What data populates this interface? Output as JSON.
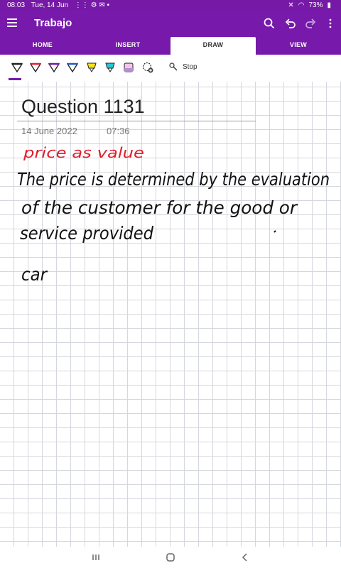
{
  "status": {
    "time": "08:03",
    "date": "Tue, 14 Jun",
    "battery": "73%"
  },
  "app": {
    "title": "Trabajo"
  },
  "tabs": [
    {
      "label": "HOME"
    },
    {
      "label": "INSERT"
    },
    {
      "label": "DRAW",
      "active": true
    },
    {
      "label": "VIEW"
    }
  ],
  "toolbar": {
    "pens": [
      "black-pen",
      "red-pen",
      "purple-pen",
      "blue-pen",
      "yellow-highlighter",
      "cyan-highlighter",
      "pink-highlighter",
      "add-tool"
    ],
    "stop_label": "Stop"
  },
  "page": {
    "title": "Question 1131",
    "date": "14 June 2022",
    "time": "07:36",
    "ink": {
      "heading": "price as value",
      "line1": "The price is determined by the evaluation",
      "line2": "of the customer for the good or",
      "line3": "service provided",
      "line4": "car"
    }
  },
  "colors": {
    "accent": "#7719aa",
    "heading_ink": "#e01e2d",
    "ink": "#111111"
  }
}
